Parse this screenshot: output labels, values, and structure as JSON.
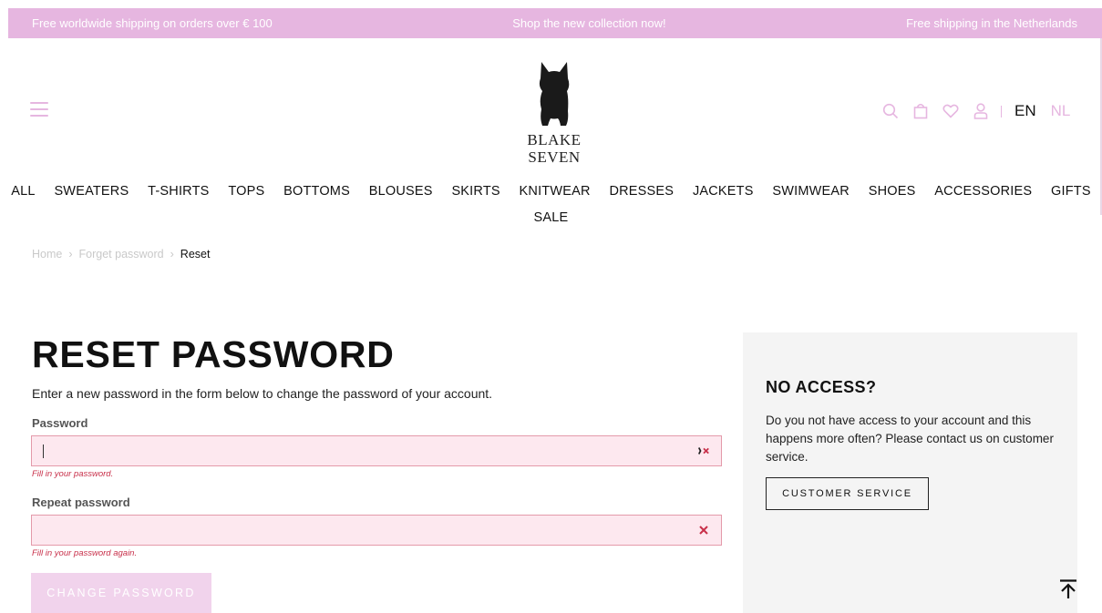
{
  "topbar": {
    "left": "Free worldwide shipping on orders over € 100",
    "center": "Shop the new collection now!",
    "right": "Free shipping in the Netherlands"
  },
  "logo": {
    "line1": "BLAKE",
    "line2": "SEVEN"
  },
  "header": {
    "icons": [
      "hamburger-menu-icon",
      "search-icon",
      "shopping-bag-icon",
      "heart-icon",
      "user-icon"
    ],
    "lang_active": "EN",
    "lang_inactive": "NL"
  },
  "nav": {
    "row1": [
      "ALL",
      "SWEATERS",
      "T-SHIRTS",
      "TOPS",
      "BOTTOMS",
      "BLOUSES",
      "SKIRTS",
      "KNITWEAR",
      "DRESSES",
      "JACKETS",
      "SWIMWEAR",
      "SHOES",
      "ACCESSORIES",
      "GIFTS"
    ],
    "row2": [
      "SALE"
    ]
  },
  "breadcrumb": {
    "home": "Home",
    "forget": "Forget password",
    "current": "Reset"
  },
  "form": {
    "title": "RESET PASSWORD",
    "intro": "Enter a new password in the form below to change the password of your account.",
    "password_label": "Password",
    "password_value": "",
    "password_error": "Fill in your password.",
    "repeat_label": "Repeat password",
    "repeat_value": "",
    "repeat_error": "Fill in your password again.",
    "submit_label": "CHANGE PASSWORD"
  },
  "side": {
    "title": "NO ACCESS?",
    "text": "Do you not have access to your account and this happens more often? Please contact us on customer service.",
    "button_label": "CUSTOMER SERVICE"
  },
  "colors": {
    "accent_pink": "#e6b6e0",
    "error_red": "#c8304a",
    "field_error_bg": "#fde8ef",
    "panel_bg": "#f4f4f4"
  }
}
